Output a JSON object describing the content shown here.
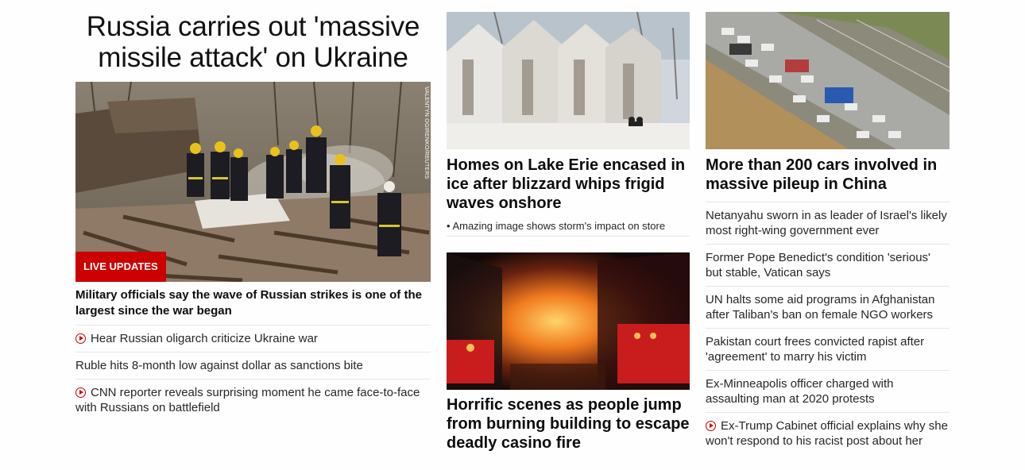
{
  "left": {
    "headline": "Russia carries out 'massive missile attack' on Ukraine",
    "image_credit": "VALENTYN OGIRENKO/REUTERS",
    "badge": "LIVE UPDATES",
    "lead": "Military officials say the wave of Russian strikes is one of the largest since the war began",
    "items": [
      {
        "text": "Hear Russian oligarch criticize Ukraine war",
        "video": true
      },
      {
        "text": "Ruble hits 8-month low against dollar as sanctions bite",
        "video": false
      },
      {
        "text": "CNN reporter reveals surprising moment he came face-to-face with Russians on battlefield",
        "video": true
      }
    ]
  },
  "middle": {
    "story1": {
      "headline": "Homes on Lake Erie encased in ice after blizzard whips frigid waves onshore",
      "sub": "• Amazing image shows storm's impact on store"
    },
    "story2": {
      "headline": "Horrific scenes as people jump from burning building to escape deadly casino fire"
    }
  },
  "right": {
    "headline": "More than 200 cars involved in massive pileup in China",
    "items": [
      {
        "text": "Netanyahu sworn in as leader of Israel's likely most right-wing government ever",
        "video": false
      },
      {
        "text": "Former Pope Benedict's condition 'serious' but stable, Vatican says",
        "video": false
      },
      {
        "text": "UN halts some aid programs in Afghanistan after Taliban's ban on female NGO workers",
        "video": false
      },
      {
        "text": "Pakistan court frees convicted rapist after 'agreement' to marry his victim",
        "video": false
      },
      {
        "text": "Ex-Minneapolis officer charged with assaulting man at 2020 protests",
        "video": false
      },
      {
        "text": "Ex-Trump Cabinet official explains why she won't respond to his racist post about her",
        "video": true
      }
    ]
  },
  "colors": {
    "accent": "#cc0000",
    "divider": "#e6e6e6"
  }
}
